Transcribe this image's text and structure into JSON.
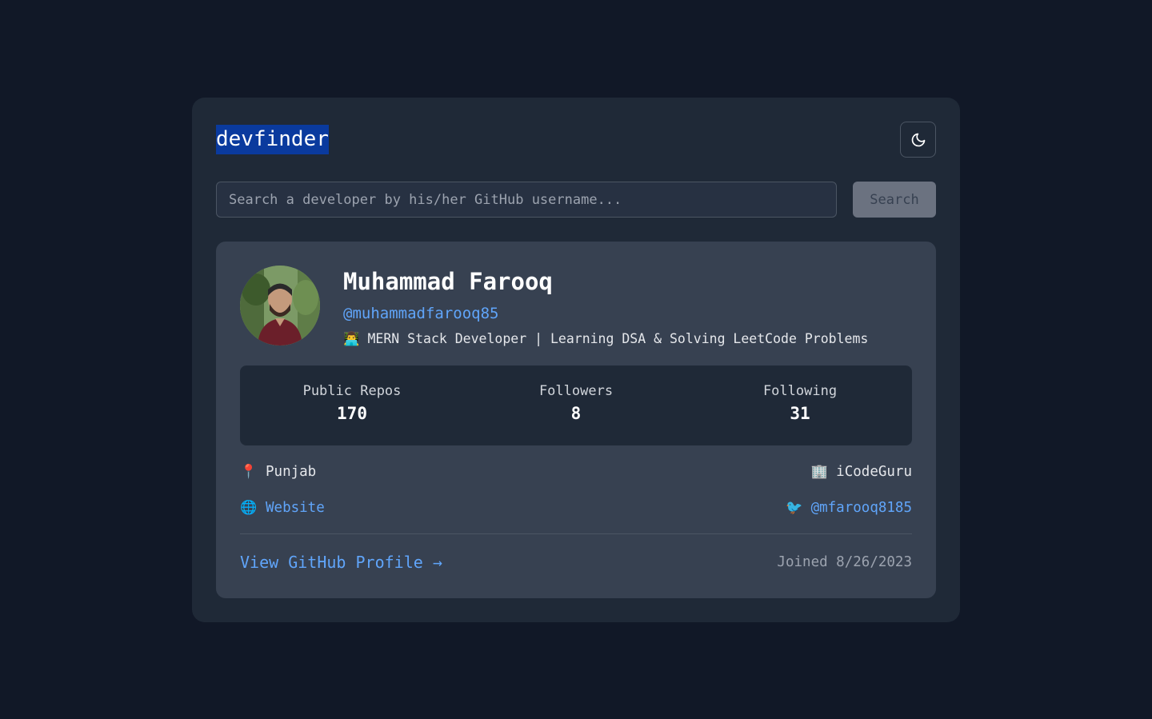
{
  "header": {
    "logo": "devfinder",
    "theme_icon": "moon-icon"
  },
  "search": {
    "placeholder": "Search a developer by his/her GitHub username...",
    "value": "",
    "button_label": "Search"
  },
  "profile": {
    "name": "Muhammad Farooq",
    "username": "@muhammadfarooq85",
    "bio": "👨‍💻 MERN Stack Developer | Learning DSA & Solving LeetCode Problems",
    "stats": [
      {
        "label": "Public Repos",
        "value": "170"
      },
      {
        "label": "Followers",
        "value": "8"
      },
      {
        "label": "Following",
        "value": "31"
      }
    ],
    "location": {
      "icon": "📍",
      "text": "Punjab"
    },
    "company": {
      "icon": "🏢",
      "text": "iCodeGuru"
    },
    "website": {
      "icon": "🌐",
      "text": "Website"
    },
    "twitter": {
      "icon": "🐦",
      "text": "@mfarooq8185"
    },
    "github_link": "View GitHub Profile →",
    "joined": "Joined 8/26/2023"
  },
  "colors": {
    "page_bg": "#111827",
    "card_bg": "#1f2937",
    "profile_bg": "#374151",
    "accent": "#60a5fa"
  }
}
